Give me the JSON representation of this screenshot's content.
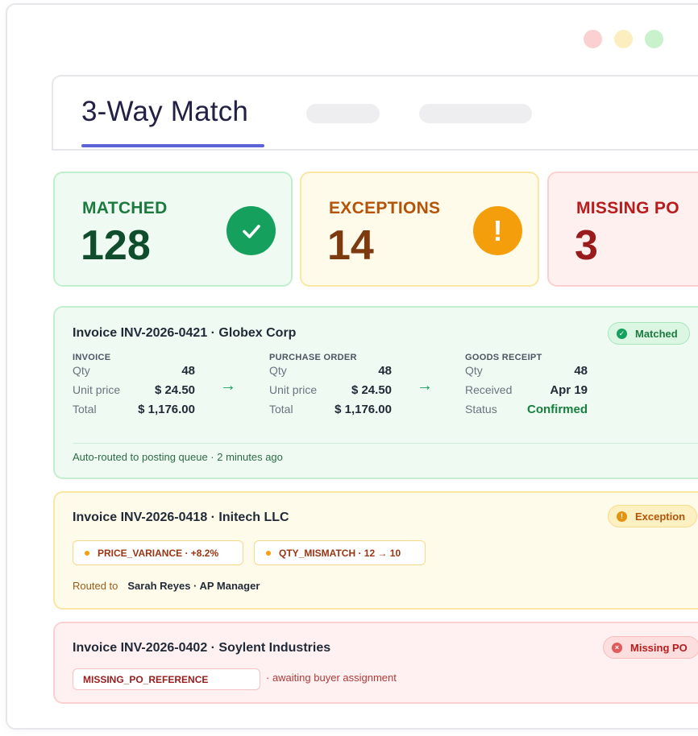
{
  "window": {
    "controls": [
      "close",
      "minimize",
      "maximize"
    ]
  },
  "header": {
    "active_tab": "3-Way Match"
  },
  "stats": {
    "matched": {
      "label": "MATCHED",
      "value": "128",
      "icon": "check-circle-icon"
    },
    "exceptions": {
      "label": "EXCEPTIONS",
      "value": "14",
      "icon": "exclamation-circle-icon"
    },
    "missing": {
      "label": "MISSING PO",
      "value": "3"
    }
  },
  "invoices": [
    {
      "title": "Invoice INV-2026-0421 · Globex Corp",
      "status": "Matched",
      "invoice": {
        "heading": "INVOICE",
        "qty_label": "Qty",
        "qty": "48",
        "price_label": "Unit price",
        "price": "$ 24.50",
        "total_label": "Total",
        "total": "$ 1,176.00"
      },
      "purchase_order": {
        "heading": "PURCHASE ORDER",
        "qty_label": "Qty",
        "qty": "48",
        "price_label": "Unit price",
        "price": "$ 24.50",
        "total_label": "Total",
        "total": "$ 1,176.00"
      },
      "goods_receipt": {
        "heading": "GOODS RECEIPT",
        "qty_label": "Qty",
        "qty": "48",
        "received_label": "Received",
        "received": "Apr 19",
        "status_label": "Status",
        "status": "Confirmed"
      },
      "arrow": "→",
      "footer": "Auto-routed to posting queue · 2 minutes ago"
    },
    {
      "title": "Invoice INV-2026-0418 · Initech LLC",
      "status": "Exception",
      "flags": [
        "PRICE_VARIANCE · +8.2%",
        "QTY_MISMATCH · 12 → 10"
      ],
      "routed_label": "Routed to",
      "routed_to": "Sarah Reyes · AP Manager"
    },
    {
      "title": "Invoice INV-2026-0402 · Soylent Industries",
      "status": "Missing PO",
      "flag": "MISSING_PO_REFERENCE",
      "note": "· awaiting buyer assignment"
    }
  ],
  "colors": {
    "accent": "#5b63d6",
    "success": "#16a05d",
    "warning": "#f59e0b",
    "danger": "#b91c1c"
  }
}
